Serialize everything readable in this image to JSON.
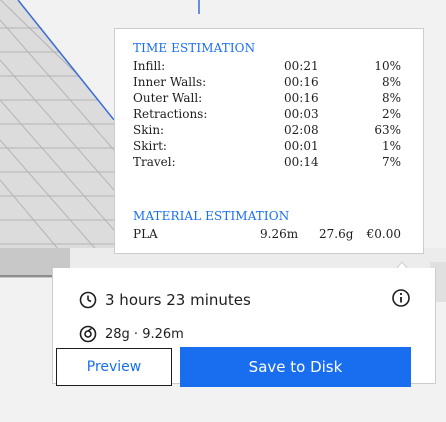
{
  "time_estimation": {
    "title": "TIME ESTIMATION",
    "rows": [
      {
        "label": "Infill:",
        "time": "00:21",
        "percent": "10%"
      },
      {
        "label": "Inner Walls:",
        "time": "00:16",
        "percent": "8%"
      },
      {
        "label": "Outer Wall:",
        "time": "00:16",
        "percent": "8%"
      },
      {
        "label": "Retractions:",
        "time": "00:03",
        "percent": "2%"
      },
      {
        "label": "Skin:",
        "time": "02:08",
        "percent": "63%"
      },
      {
        "label": "Skirt:",
        "time": "00:01",
        "percent": "1%"
      },
      {
        "label": "Travel:",
        "time": "00:14",
        "percent": "7%"
      }
    ]
  },
  "material_estimation": {
    "title": "MATERIAL ESTIMATION",
    "material": "PLA",
    "length": "9.26m",
    "weight": "27.6g",
    "cost": "€0.00"
  },
  "summary": {
    "print_time": "3 hours 23 minutes",
    "material_usage": "28g · 9.26m"
  },
  "buttons": {
    "preview": "Preview",
    "save": "Save to Disk"
  },
  "colors": {
    "accent": "#196ef0",
    "text": "#1e1e1e"
  },
  "icons": {
    "clock": "clock-icon",
    "info": "info-icon",
    "spool": "spool-icon"
  }
}
